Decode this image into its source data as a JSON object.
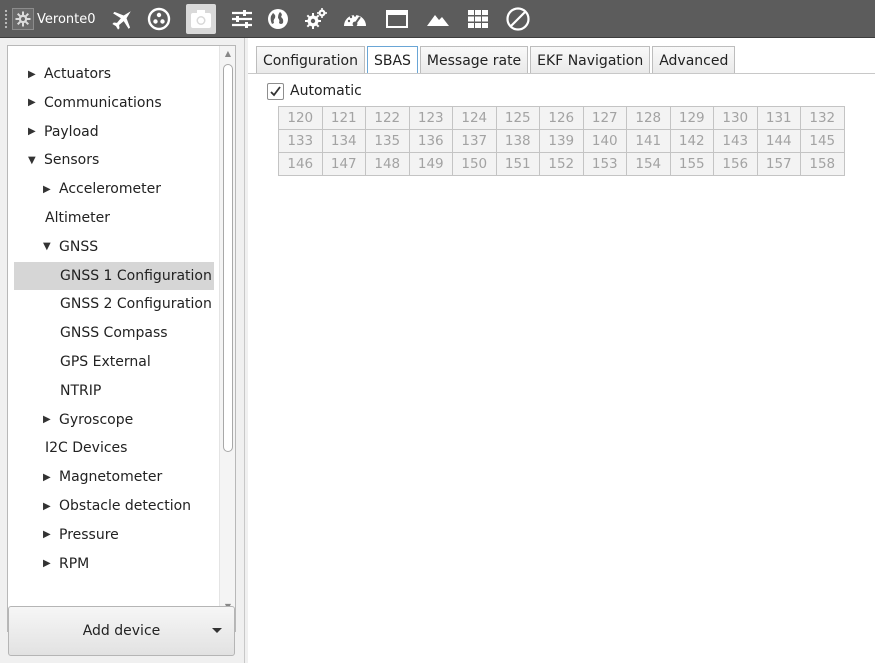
{
  "toolbar": {
    "device_label": "Veronte0",
    "icons": [
      "airplane-icon",
      "radiation-icon",
      "camera-icon",
      "sliders-icon",
      "globe-icon",
      "gears-icon",
      "gauge-icon",
      "window-icon",
      "mountain-icon",
      "grid-icon",
      "prohibited-icon"
    ],
    "active_icon": "camera-icon"
  },
  "tree": {
    "items": [
      {
        "label": "Actuators",
        "level": 0,
        "arrow": "▶"
      },
      {
        "label": "Communications",
        "level": 0,
        "arrow": "▶"
      },
      {
        "label": "Payload",
        "level": 0,
        "arrow": "▶"
      },
      {
        "label": "Sensors",
        "level": 0,
        "arrow": "▼"
      },
      {
        "label": "Accelerometer",
        "level": 1,
        "arrow": "▶"
      },
      {
        "label": "Altimeter",
        "level": 1,
        "arrow": ""
      },
      {
        "label": "GNSS",
        "level": 1,
        "arrow": "▼"
      },
      {
        "label": "GNSS 1 Configuration",
        "level": 2,
        "arrow": "",
        "selected": true
      },
      {
        "label": "GNSS 2 Configuration",
        "level": 2,
        "arrow": ""
      },
      {
        "label": "GNSS Compass",
        "level": 2,
        "arrow": ""
      },
      {
        "label": "GPS External",
        "level": 2,
        "arrow": ""
      },
      {
        "label": "NTRIP",
        "level": 2,
        "arrow": ""
      },
      {
        "label": "Gyroscope",
        "level": 1,
        "arrow": "▶"
      },
      {
        "label": "I2C Devices",
        "level": 1,
        "arrow": ""
      },
      {
        "label": "Magnetometer",
        "level": 1,
        "arrow": "▶"
      },
      {
        "label": "Obstacle detection",
        "level": 1,
        "arrow": "▶"
      },
      {
        "label": "Pressure",
        "level": 1,
        "arrow": "▶"
      },
      {
        "label": "RPM",
        "level": 1,
        "arrow": "▶"
      }
    ]
  },
  "add_device_label": "Add device",
  "tabs": [
    {
      "label": "Configuration",
      "active": false
    },
    {
      "label": "SBAS",
      "active": true
    },
    {
      "label": "Message rate",
      "active": false
    },
    {
      "label": "EKF Navigation",
      "active": false
    },
    {
      "label": "Advanced",
      "active": false
    }
  ],
  "sbas": {
    "automatic_label": "Automatic",
    "automatic_checked": true,
    "prns": [
      "120",
      "121",
      "122",
      "123",
      "124",
      "125",
      "126",
      "127",
      "128",
      "129",
      "130",
      "131",
      "132",
      "133",
      "134",
      "135",
      "136",
      "137",
      "138",
      "139",
      "140",
      "141",
      "142",
      "143",
      "144",
      "145",
      "146",
      "147",
      "148",
      "149",
      "150",
      "151",
      "152",
      "153",
      "154",
      "155",
      "156",
      "157",
      "158"
    ]
  }
}
